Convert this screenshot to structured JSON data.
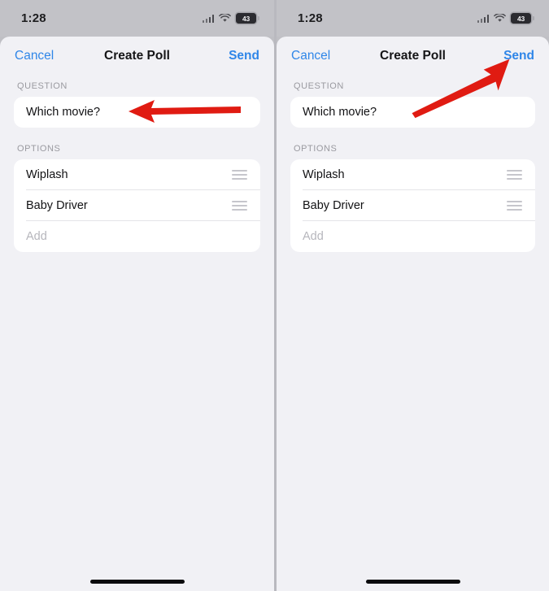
{
  "screen": {
    "background_color": "#f1f1f5",
    "sheet_color": "#f1f1f5",
    "accent_color": "#2f86e8",
    "annotation_color": "#e01b12"
  },
  "status_bar": {
    "time": "1:28",
    "cellular_icon": "cellular-signal-icon",
    "wifi_icon": "wifi-icon",
    "battery_icon": "battery-icon",
    "battery_level": "43"
  },
  "panels": [
    {
      "id": "left",
      "navbar": {
        "cancel_label": "Cancel",
        "title": "Create Poll",
        "send_label": "Send"
      },
      "question_section": {
        "label": "QUESTION",
        "value": "Which movie?"
      },
      "options_section": {
        "label": "OPTIONS",
        "items": [
          {
            "value": "Wiplash",
            "handle_icon": "reorder-handle-icon"
          },
          {
            "value": "Baby Driver",
            "handle_icon": "reorder-handle-icon"
          }
        ],
        "add_placeholder": "Add"
      },
      "annotation": {
        "type": "arrow-left",
        "points_to": "question-field"
      }
    },
    {
      "id": "right",
      "navbar": {
        "cancel_label": "Cancel",
        "title": "Create Poll",
        "send_label": "Send"
      },
      "question_section": {
        "label": "QUESTION",
        "value": "Which movie?"
      },
      "options_section": {
        "label": "OPTIONS",
        "items": [
          {
            "value": "Wiplash",
            "handle_icon": "reorder-handle-icon"
          },
          {
            "value": "Baby Driver",
            "handle_icon": "reorder-handle-icon"
          }
        ],
        "add_placeholder": "Add"
      },
      "annotation": {
        "type": "arrow-diagonal-up-right",
        "points_to": "send-button"
      }
    }
  ]
}
